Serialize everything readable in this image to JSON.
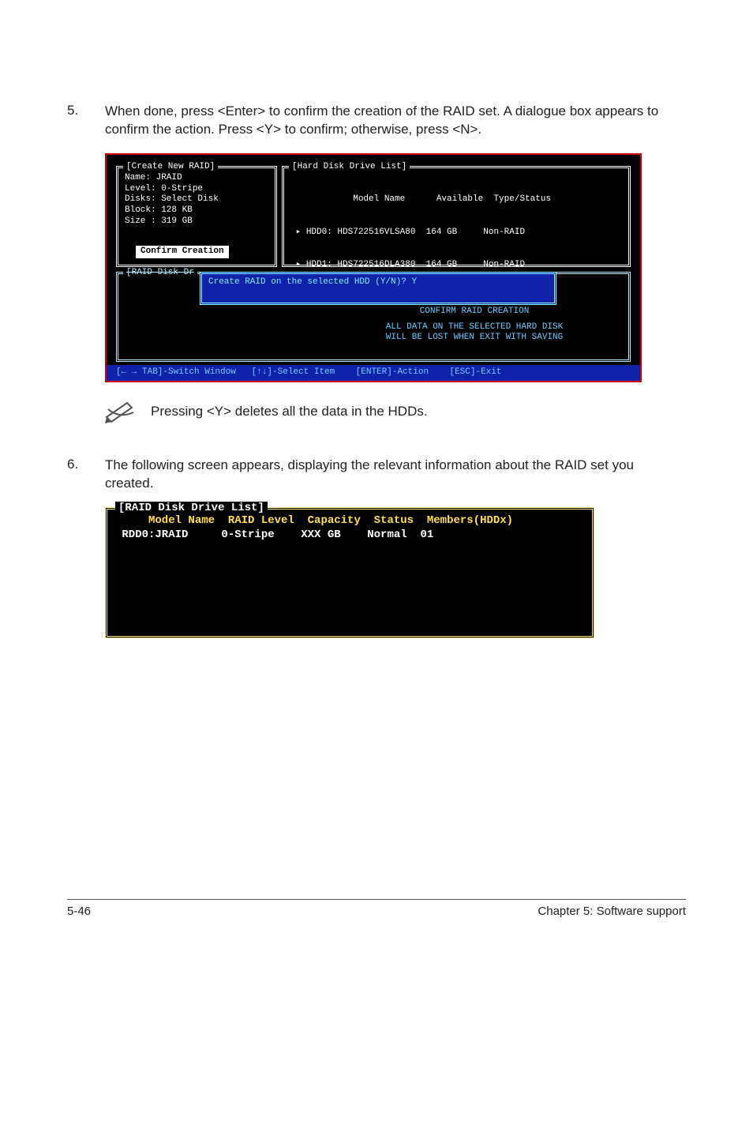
{
  "step5": {
    "num": "5.",
    "text": "When done, press <Enter> to confirm the creation of the RAID set. A dialogue box appears to confirm the action. Press <Y> to confirm; otherwise, press <N>."
  },
  "bios1": {
    "create_panel": {
      "title": "[Create New RAID]",
      "lines": {
        "a": "Name: JRAID",
        "b": "Level: 0-Stripe",
        "c": "Disks: Select Disk",
        "d": "Block: 128 KB",
        "e": "Size : 319 GB"
      },
      "confirm_label": "Confirm Creation"
    },
    "hdd_panel": {
      "title": "[Hard Disk Drive List]",
      "header": "            Model Name      Available  Type/Status",
      "r0": " ▸ HDD0: HDS722516VLSA80  164 GB     Non-RAID",
      "r1": " ▸ HDD1: HDS722516DLA380  164 GB     Non-RAID"
    },
    "raidlist_title": "[RAID Disk Dr",
    "prompt": "Create RAID on the selected HDD (Y/N)? Y",
    "warn_title": "CONFIRM RAID CREATION",
    "warn_l1": "ALL DATA ON THE SELECTED HARD DISK",
    "warn_l2": "WILL BE LOST WHEN EXIT WITH SAVING",
    "footer": "[← → TAB]-Switch Window   [↑↓]-Select Item    [ENTER]-Action    [ESC]-Exit"
  },
  "note_text": "Pressing <Y> deletes all the data in the HDDs.",
  "step6": {
    "num": "6.",
    "text": "The following screen appears, displaying the relevant information about the RAID set you created."
  },
  "bios2": {
    "title": "[RAID Disk Drive List]",
    "headers": "     Model Name  RAID Level  Capacity  Status  Members(HDDx)",
    "row0": " RDD0:JRAID     0-Stripe    XXX GB    Normal  01"
  },
  "footer": {
    "left": "5-46",
    "right": "Chapter 5: Software support"
  },
  "chart_data": {
    "type": "table",
    "title": "[RAID Disk Drive List]",
    "columns": [
      "Model Name",
      "RAID Level",
      "Capacity",
      "Status",
      "Members(HDDx)"
    ],
    "rows": [
      {
        "Model Name": "RDD0:JRAID",
        "RAID Level": "0-Stripe",
        "Capacity": "XXX GB",
        "Status": "Normal",
        "Members(HDDx)": "01"
      }
    ]
  }
}
